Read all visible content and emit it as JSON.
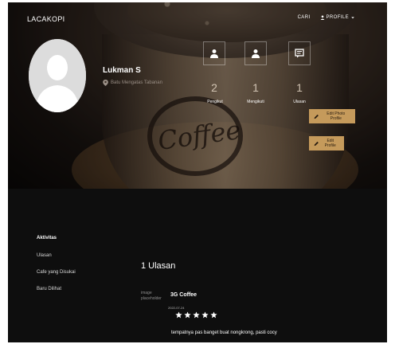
{
  "nav": {
    "brand": "LACAKOPI",
    "cari_label": "CARI",
    "profile_label": "PROFILE"
  },
  "profile": {
    "name": "Lukman S",
    "location": "Batu Mengatas Tabanan",
    "stats": [
      {
        "icon": "user-icon",
        "count": "2",
        "label": "Pengikut"
      },
      {
        "icon": "user-icon",
        "count": "1",
        "label": "Mengikuti"
      },
      {
        "icon": "review-icon",
        "count": "1",
        "label": "Ulasan"
      }
    ],
    "edit_photo_label": "Edit Photo Profile",
    "edit_profile_label": "Edit Profile"
  },
  "sidebar": {
    "title": "Aktivitas",
    "items": [
      "Ulasan",
      "Cafe yang Disukai",
      "Baru Dilihat"
    ]
  },
  "reviews": {
    "heading": "1 Ulasan",
    "items": [
      {
        "image_alt": "image placeholder",
        "place": "3G Coffee",
        "date": "2022-07-24",
        "rating": 5,
        "text": "tempatnya pas banget buat nongkrong, pasti cocy"
      }
    ]
  },
  "colors": {
    "accent": "#c59a5b",
    "background": "#0e0e0e"
  }
}
